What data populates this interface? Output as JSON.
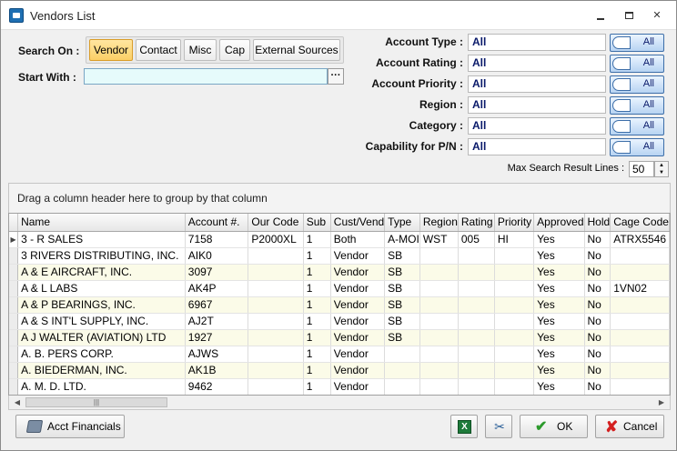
{
  "window": {
    "title": "Vendors List"
  },
  "search": {
    "search_on_label": "Search On :",
    "start_with_label": "Start With :",
    "start_with_value": "",
    "tabs": [
      "Vendor",
      "Contact",
      "Misc",
      "Cap",
      "External Sources"
    ],
    "active_tab": "Vendor",
    "ellipsis_label": "···"
  },
  "filters": [
    {
      "label": "Account Type :",
      "value": "All",
      "button": "All"
    },
    {
      "label": "Account Rating :",
      "value": "All",
      "button": "All"
    },
    {
      "label": "Account Priority :",
      "value": "All",
      "button": "All"
    },
    {
      "label": "Region :",
      "value": "All",
      "button": "All"
    },
    {
      "label": "Category :",
      "value": "All",
      "button": "All"
    },
    {
      "label": "Capability for P/N :",
      "value": "All",
      "button": "All"
    }
  ],
  "max_results": {
    "label": "Max Search Result Lines :",
    "value": "50"
  },
  "group_hint": "Drag a column header here to group by that column",
  "grid": {
    "columns": [
      "Name",
      "Account #.",
      "Our Code",
      "Sub",
      "Cust/Vend",
      "Type",
      "Region",
      "Rating",
      "Priority",
      "Approved",
      "Hold",
      "Cage Code"
    ],
    "rows": [
      [
        "3 - R SALES",
        "7158",
        "P2000XL",
        "1",
        "Both",
        "A-MOI",
        "WST",
        "005",
        "HI",
        "Yes",
        "No",
        "ATRX5546"
      ],
      [
        "3 RIVERS DISTRIBUTING, INC.",
        "AIK0",
        "",
        "1",
        "Vendor",
        "SB",
        "",
        "",
        "",
        "Yes",
        "No",
        ""
      ],
      [
        "A & E AIRCRAFT, INC.",
        "3097",
        "",
        "1",
        "Vendor",
        "SB",
        "",
        "",
        "",
        "Yes",
        "No",
        ""
      ],
      [
        "A & L LABS",
        "AK4P",
        "",
        "1",
        "Vendor",
        "SB",
        "",
        "",
        "",
        "Yes",
        "No",
        "1VN02"
      ],
      [
        "A & P BEARINGS, INC.",
        "6967",
        "",
        "1",
        "Vendor",
        "SB",
        "",
        "",
        "",
        "Yes",
        "No",
        ""
      ],
      [
        "A & S INT'L SUPPLY, INC.",
        "AJ2T",
        "",
        "1",
        "Vendor",
        "SB",
        "",
        "",
        "",
        "Yes",
        "No",
        ""
      ],
      [
        "A J WALTER (AVIATION) LTD",
        "1927",
        "",
        "1",
        "Vendor",
        "SB",
        "",
        "",
        "",
        "Yes",
        "No",
        ""
      ],
      [
        "A. B. PERS CORP.",
        "AJWS",
        "",
        "1",
        "Vendor",
        "",
        "",
        "",
        "",
        "Yes",
        "No",
        ""
      ],
      [
        "A. BIEDERMAN, INC.",
        "AK1B",
        "",
        "1",
        "Vendor",
        "",
        "",
        "",
        "",
        "Yes",
        "No",
        ""
      ],
      [
        "A. M. D. LTD.",
        "9462",
        "",
        "1",
        "Vendor",
        "",
        "",
        "",
        "",
        "Yes",
        "No",
        ""
      ]
    ]
  },
  "buttons": {
    "acct_financials": "Acct Financials",
    "excel_icon_text": "X",
    "ok": "OK",
    "cancel": "Cancel"
  },
  "icons": {
    "app": "vendors-list-icon",
    "excel": "excel-export-icon",
    "tools": "tools-icon",
    "ok": "checkmark-icon",
    "cancel": "x-icon"
  },
  "colors": {
    "active_tab": "#fbcf66",
    "start_input_bg": "#e6fbfb",
    "filter_value_text": "#0a1a6a",
    "row_alt": "#fbfbe8",
    "ok_icon": "#2c9a2c",
    "cancel_icon": "#d42020"
  }
}
